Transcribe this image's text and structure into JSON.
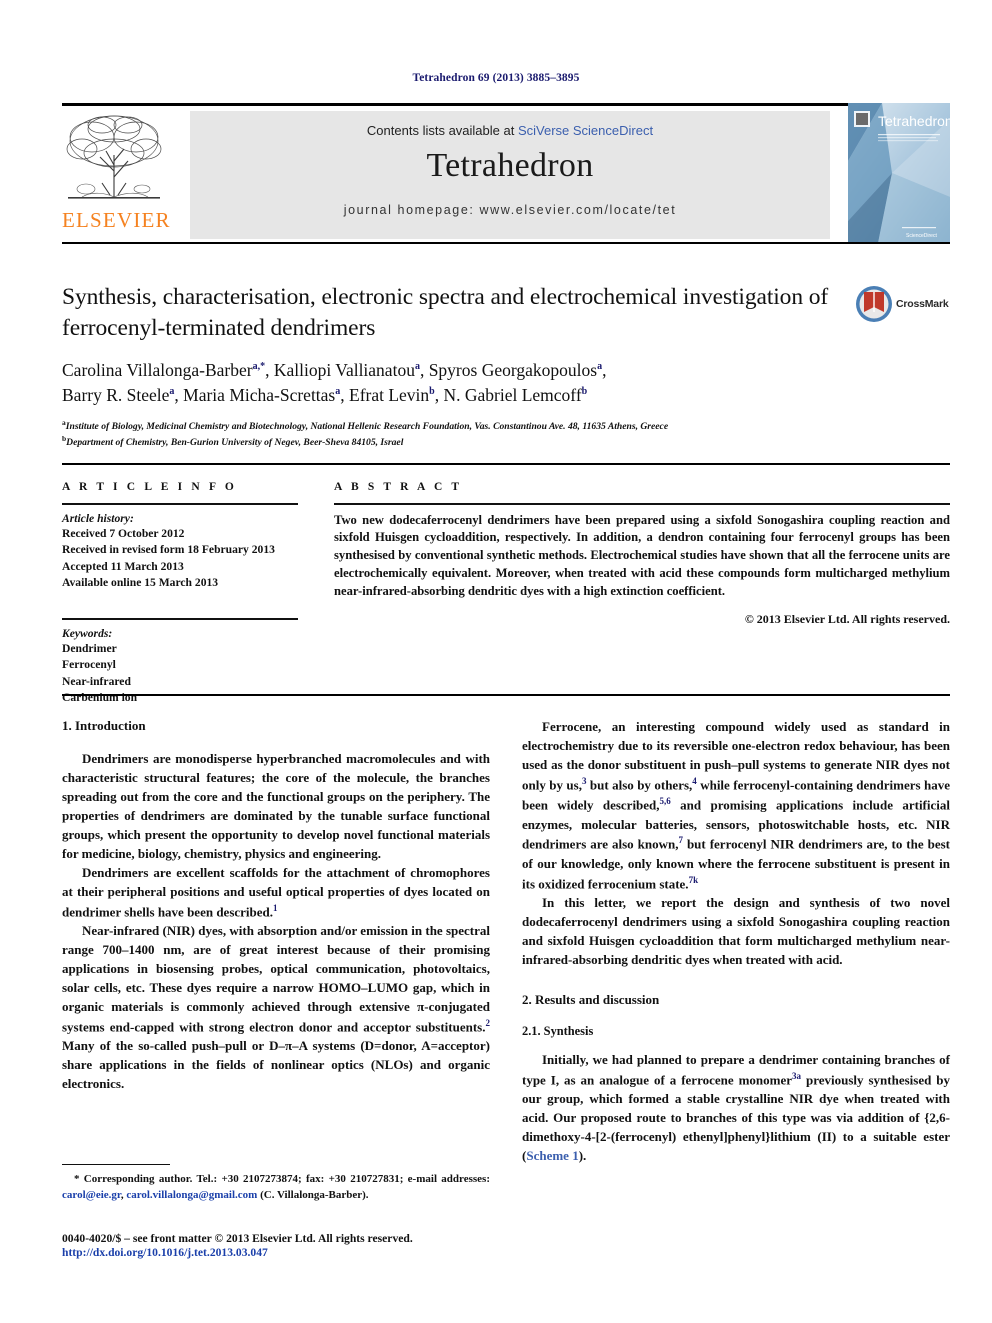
{
  "running_head": "Tetrahedron 69 (2013) 3885–3895",
  "masthead": {
    "publisher_name": "ELSEVIER",
    "contents_prefix": "Contents lists available at ",
    "contents_link": "SciVerse ScienceDirect",
    "journal_title": "Tetrahedron",
    "homepage": "journal homepage: www.elsevier.com/locate/tet",
    "cover_title": "Tetrahedron",
    "cover_subtitle": "The International Journal for the Rapid Publication of Full Original Research Papers and Critical Reviews in Organic Chemistry",
    "cover_footer": "ScienceDirect"
  },
  "article": {
    "title": "Synthesis, characterisation, electronic spectra and electrochemical investigation of ferrocenyl-terminated dendrimers",
    "crossmark_label": "CrossMark",
    "authors_line1_parts": [
      {
        "name": "Carolina Villalonga-Barber",
        "sup": "a,*"
      },
      {
        "name": "Kalliopi Vallianatou",
        "sup": "a"
      },
      {
        "name": "Spyros Georgakopoulos",
        "sup": "a"
      }
    ],
    "authors_line2_parts": [
      {
        "name": "Barry R. Steele",
        "sup": "a"
      },
      {
        "name": "Maria Micha-Screttas",
        "sup": "a"
      },
      {
        "name": "Efrat Levin",
        "sup": "b"
      },
      {
        "name": "N. Gabriel Lemcoff",
        "sup": "b"
      }
    ],
    "affiliations": [
      {
        "marker": "a",
        "text": "Institute of Biology, Medicinal Chemistry and Biotechnology, National Hellenic Research Foundation, Vas. Constantinou Ave. 48, 11635 Athens, Greece"
      },
      {
        "marker": "b",
        "text": "Department of Chemistry, Ben-Gurion University of Negev, Beer-Sheva 84105, Israel"
      }
    ]
  },
  "article_info": {
    "heading": "A R T I C L E   I N F O",
    "history_label": "Article history:",
    "history": [
      "Received 7 October 2012",
      "Received in revised form 18 February 2013",
      "Accepted 11 March 2013",
      "Available online 15 March 2013"
    ],
    "keywords_label": "Keywords:",
    "keywords": [
      "Dendrimer",
      "Ferrocenyl",
      "Near-infrared",
      "Carbenium ion"
    ]
  },
  "abstract": {
    "heading": "A B S T R A C T",
    "text": "Two new dodecaferrocenyl dendrimers have been prepared using a sixfold Sonogashira coupling reaction and sixfold Huisgen cycloaddition, respectively. In addition, a dendron containing four ferrocenyl groups has been synthesised by conventional synthetic methods. Electrochemical studies have shown that all the ferrocene units are electrochemically equivalent. Moreover, when treated with acid these compounds form multicharged methylium near-infrared-absorbing dendritic dyes with a high extinction coefficient.",
    "copyright": "© 2013 Elsevier Ltd. All rights reserved."
  },
  "body": {
    "left": {
      "section_heading": "1. Introduction",
      "paragraphs": [
        {
          "parts": [
            {
              "t": "Dendrimers are monodisperse hyperbranched macromolecules and with characteristic structural features; the core of the molecule, the branches spreading out from the core and the functional groups on the periphery. The properties of dendrimers are dominated by the tunable surface functional groups, which present the opportunity to develop novel functional materials for medicine, biology, chemistry, physics and engineering."
            }
          ]
        },
        {
          "parts": [
            {
              "t": "Dendrimers are excellent scaffolds for the attachment of chromophores at their peripheral positions and useful optical properties of dyes located on dendrimer shells have been described."
            },
            {
              "sup": "1"
            },
            {
              "t": ""
            }
          ]
        },
        {
          "parts": [
            {
              "t": "Near-infrared (NIR) dyes, with absorption and/or emission in the spectral range 700–1400 nm, are of great interest because of their promising applications in biosensing probes, optical communication, photovoltaics, solar cells, etc. These dyes require a narrow HOMO–LUMO gap, which in organic materials is commonly achieved through extensive π-conjugated systems end-capped with strong electron donor and acceptor substituents."
            },
            {
              "sup": "2"
            },
            {
              "t": " Many of the so-called push–pull or D–π–A systems (D=donor, A=acceptor) share applications in the fields of nonlinear optics (NLOs) and organic electronics."
            }
          ]
        }
      ]
    },
    "right": {
      "paragraphs": [
        {
          "parts": [
            {
              "t": "Ferrocene, an interesting compound widely used as standard in electrochemistry due to its reversible one-electron redox behaviour, has been used as the donor substituent in push–pull systems to generate NIR dyes not only by us,"
            },
            {
              "sup": "3"
            },
            {
              "t": " but also by others,"
            },
            {
              "sup": "4"
            },
            {
              "t": " while ferrocenyl-containing dendrimers have been widely described,"
            },
            {
              "sup": "5,6"
            },
            {
              "t": " and promising applications include artificial enzymes, molecular batteries, sensors, photoswitchable hosts, etc. NIR dendrimers are also known,"
            },
            {
              "sup": "7"
            },
            {
              "t": " but ferrocenyl NIR dendrimers are, to the best of our knowledge, only known where the ferrocene substituent is present in its oxidized ferrocenium state."
            },
            {
              "sup": "7k"
            },
            {
              "t": ""
            }
          ]
        },
        {
          "parts": [
            {
              "t": "In this letter, we report the design and synthesis of two novel dodecaferrocenyl dendrimers using a sixfold Sonogashira coupling reaction and sixfold Huisgen cycloaddition that form multicharged methylium near-infrared-absorbing dendritic dyes when treated with acid."
            }
          ]
        }
      ],
      "section_heading": "2. Results and discussion",
      "sub_heading": "2.1. Synthesis",
      "paragraphs_after": [
        {
          "parts": [
            {
              "t": "Initially, we had planned to prepare a dendrimer containing branches of type I, as an analogue of a ferrocene monomer"
            },
            {
              "sup": "3a"
            },
            {
              "t": " previously synthesised by our group, which formed a stable crystalline NIR dye when treated with acid. Our proposed route to branches of this type was via addition of {2,6-dimethoxy-4-[2-(ferrocenyl) ethenyl]phenyl}lithium (II) to a suitable ester ("
            },
            {
              "link": "Scheme 1"
            },
            {
              "t": ")."
            }
          ]
        }
      ]
    }
  },
  "footnote": {
    "text_before": "* Corresponding author. Tel.: +30 2107273874; fax: +30 210727831; e-mail addresses: ",
    "email1": "carol@eie.gr",
    "separator": ", ",
    "email2": "carol.villalonga@gmail.com",
    "text_after": " (C. Villalonga-Barber)."
  },
  "page_footer": {
    "issn_line": "0040-4020/$ – see front matter © 2013 Elsevier Ltd. All rights reserved.",
    "doi": "http://dx.doi.org/10.1016/j.tet.2013.03.047"
  },
  "colors": {
    "elsevier_orange": "#F58220",
    "link_blue": "#3b5fae",
    "running_head_navy": "#1a1a6e",
    "panel_grey": "#e6e6e6"
  }
}
